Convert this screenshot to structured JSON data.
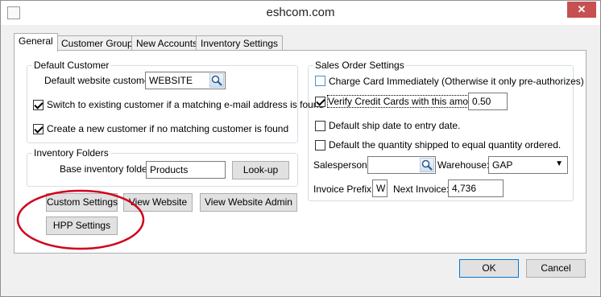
{
  "window": {
    "title": "eshcom.com",
    "close_label": "✕"
  },
  "tabs": [
    {
      "label": "General",
      "active": true
    },
    {
      "label": "Customer Groups",
      "active": false
    },
    {
      "label": "New Accounts",
      "active": false
    },
    {
      "label": "Inventory Settings",
      "active": false
    }
  ],
  "default_customer": {
    "title": "Default Customer",
    "website_customer_label": "Default website customer:",
    "website_customer_value": "WEBSITE",
    "switch_label": "Switch to existing customer if a matching e-mail address is found",
    "switch_checked": true,
    "create_label": "Create a new customer if no matching customer is found",
    "create_checked": true
  },
  "inventory_folders": {
    "title": "Inventory Folders",
    "base_folder_label": "Base inventory folder:",
    "base_folder_value": "Products",
    "lookup_button": "Look-up"
  },
  "buttons": {
    "custom_settings": "Custom Settings",
    "view_website": "View Website",
    "view_website_admin": "View Website Admin",
    "hpp_settings": "HPP Settings",
    "ok": "OK",
    "cancel": "Cancel"
  },
  "sales_order": {
    "title": "Sales Order Settings",
    "charge_card_label": "Charge Card Immediately (Otherwise it only pre-authorizes)",
    "charge_card_checked": false,
    "verify_label": "Verify Credit Cards with this amount:",
    "verify_checked": true,
    "verify_amount": "0.50",
    "default_ship_label": "Default ship date to entry date.",
    "default_ship_checked": false,
    "default_qty_label": "Default the quantity shipped to equal quantity ordered.",
    "default_qty_checked": false,
    "salesperson_label": "Salesperson:",
    "salesperson_value": "",
    "warehouse_label": "Warehouse:",
    "warehouse_value": "GAP",
    "invoice_prefix_label": "Invoice Prefix:",
    "invoice_prefix_value": "W",
    "next_invoice_label": "Next Invoice:",
    "next_invoice_value": "4,736"
  },
  "colors": {
    "annotation_circle": "#d0021b",
    "close_button": "#c75050"
  }
}
